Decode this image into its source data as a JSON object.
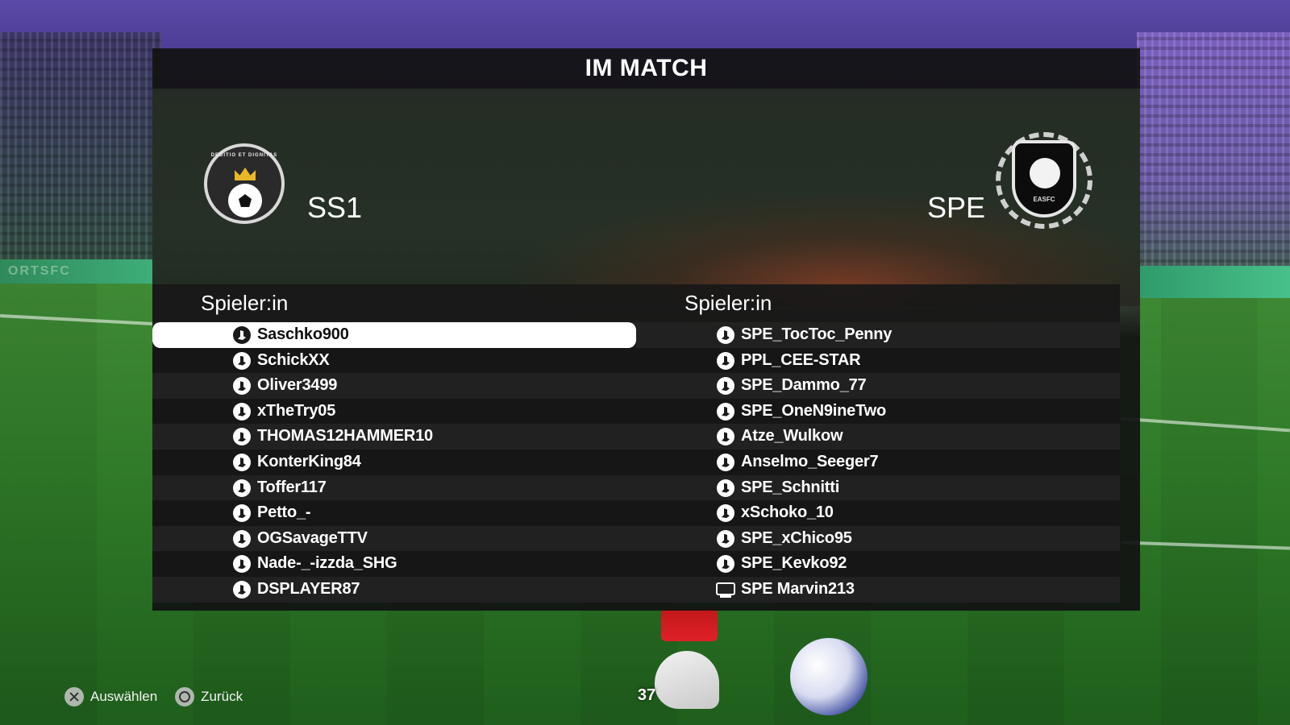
{
  "screen": {
    "title": "IM MATCH"
  },
  "home_team": {
    "short_name": "SS1",
    "crest_text": "DEDITIO ET DIGNITAS",
    "column_header": "Spieler:in",
    "players": [
      {
        "name": "Saschko900",
        "platform": "playstation-icon",
        "selected": true
      },
      {
        "name": "SchickXX",
        "platform": "playstation-icon"
      },
      {
        "name": "Oliver3499",
        "platform": "playstation-icon"
      },
      {
        "name": "xTheTry05",
        "platform": "playstation-icon"
      },
      {
        "name": "THOMAS12HAMMER10",
        "platform": "playstation-icon"
      },
      {
        "name": "KonterKing84",
        "platform": "playstation-icon"
      },
      {
        "name": "Toffer117",
        "platform": "playstation-icon"
      },
      {
        "name": "Petto_-",
        "platform": "playstation-icon"
      },
      {
        "name": "OGSavageTTV",
        "platform": "playstation-icon"
      },
      {
        "name": "Nade-_-izzda_SHG",
        "platform": "playstation-icon"
      },
      {
        "name": "DSPLAYER87",
        "platform": "playstation-icon"
      }
    ]
  },
  "away_team": {
    "short_name": "SPE",
    "crest_text": "EASFC",
    "column_header": "Spieler:in",
    "players": [
      {
        "name": "SPE_TocToc_Penny",
        "platform": "playstation-icon"
      },
      {
        "name": "PPL_CEE-STAR",
        "platform": "playstation-icon"
      },
      {
        "name": "SPE_Dammo_77",
        "platform": "playstation-icon"
      },
      {
        "name": "SPE_OneN9ineTwo",
        "platform": "playstation-icon"
      },
      {
        "name": "Atze_Wulkow",
        "platform": "playstation-icon"
      },
      {
        "name": "Anselmo_Seeger7",
        "platform": "playstation-icon"
      },
      {
        "name": "SPE_Schnitti",
        "platform": "playstation-icon"
      },
      {
        "name": "xSchoko_10",
        "platform": "playstation-icon"
      },
      {
        "name": "SPE_xChico95",
        "platform": "playstation-icon"
      },
      {
        "name": "SPE_Kevko92",
        "platform": "playstation-icon"
      },
      {
        "name": "SPE Marvin213",
        "platform": "pc-icon"
      }
    ]
  },
  "footer": {
    "select_label": "Auswählen",
    "select_icon": "cross-button-icon",
    "back_label": "Zurück",
    "back_icon": "circle-button-icon",
    "match_minute": "37"
  },
  "colors": {
    "panel": "#121212",
    "row_selected": "#ffffff",
    "text": "#ffffff"
  }
}
